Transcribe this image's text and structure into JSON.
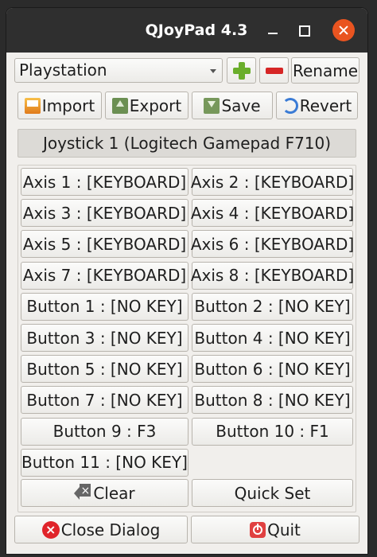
{
  "window": {
    "title": "QJoyPad 4.3"
  },
  "toolbar": {
    "layout_value": "Playstation",
    "add_icon": "plus-icon",
    "remove_icon": "minus-icon",
    "rename_label": "Rename",
    "import_label": "Import",
    "export_label": "Export",
    "save_label": "Save",
    "revert_label": "Revert"
  },
  "joystick": {
    "name": "Joystick 1 (Logitech Gamepad F710)"
  },
  "mappings": [
    "Axis 1 : [KEYBOARD]",
    "Axis 2 : [KEYBOARD]",
    "Axis 3 : [KEYBOARD]",
    "Axis 4 : [KEYBOARD]",
    "Axis 5 : [KEYBOARD]",
    "Axis 6 : [KEYBOARD]",
    "Axis 7 : [KEYBOARD]",
    "Axis 8 : [KEYBOARD]",
    "Button 1 : [NO KEY]",
    "Button 2 : [NO KEY]",
    "Button 3 : [NO KEY]",
    "Button 4 : [NO KEY]",
    "Button 5 : [NO KEY]",
    "Button 6 : [NO KEY]",
    "Button 7 : [NO KEY]",
    "Button 8 : [NO KEY]",
    "Button 9 : F3",
    "Button 10 : F1",
    "Button 11 : [NO KEY]"
  ],
  "actions": {
    "clear_label": "Clear",
    "quick_set_label": "Quick Set"
  },
  "footer": {
    "close_label": "Close Dialog",
    "quit_label": "Quit"
  },
  "colors": {
    "titlebar": "#2f2f2f",
    "close_button": "#e95420",
    "add": "#6aae2b",
    "remove": "#d62626"
  }
}
